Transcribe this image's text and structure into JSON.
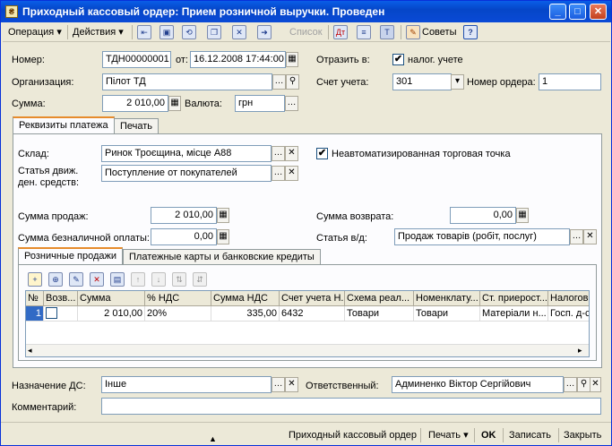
{
  "window": {
    "title": "Приходный кассовый ордер: Прием розничной выручки. Проведен",
    "minimize": "_",
    "maximize": "□",
    "close": "✕"
  },
  "toolbar": {
    "operation": "Операция",
    "actions": "Действия",
    "list": "Список",
    "tips": "Советы",
    "help": "?",
    "dropdown_arrow": "▾"
  },
  "header": {
    "number_label": "Номер:",
    "number_value": "ТДН00000001",
    "from_label": "от:",
    "date_value": "16.12.2008 17:44:00",
    "reflect_label": "Отразить в:",
    "tax_accounting_label": "налог. учете",
    "tax_accounting_checked": "✔",
    "org_label": "Организация:",
    "org_value": "Пілот ТД",
    "account_label": "Счет учета:",
    "account_value": "301",
    "order_no_label": "Номер ордера:",
    "order_no_value": "1",
    "sum_label": "Сумма:",
    "sum_value": "2 010,00",
    "currency_label": "Валюта:",
    "currency_value": "грн"
  },
  "tabs": {
    "payment_details": "Реквизиты платежа",
    "print": "Печать"
  },
  "payment": {
    "warehouse_label": "Склад:",
    "warehouse_value": "Ринок Троєщина, місце А88",
    "non_auto_label": "Неавтоматизированная торговая точка",
    "non_auto_checked": "✔",
    "cashflow_label_1": "Статья движ.",
    "cashflow_label_2": "ден. средств:",
    "cashflow_value": "Поступление от покупателей",
    "sales_sum_label": "Сумма продаж:",
    "sales_sum_value": "2 010,00",
    "return_sum_label": "Сумма возврата:",
    "return_sum_value": "0,00",
    "cashless_label": "Сумма безналичной оплаты:",
    "cashless_value": "0,00",
    "income_item_label": "Статья в/д:",
    "income_item_value": "Продаж товарів (робіт, послуг)"
  },
  "subtabs": {
    "retail": "Розничные продажи",
    "cards": "Платежные карты и банковские кредиты"
  },
  "table": {
    "columns": [
      "№",
      "Возв...",
      "Сумма",
      "% НДС",
      "Сумма НДС",
      "Счет учета Н...",
      "Схема реал...",
      "Номенклату...",
      "Ст. приерост...",
      "Налогов"
    ],
    "rows": [
      [
        "1",
        "",
        "2 010,00",
        "20%",
        "335,00",
        "6432",
        "Товари",
        "Товари",
        "Матеріали н...",
        "Госп. д-сть"
      ]
    ]
  },
  "footer": {
    "purpose_label": "Назначение ДС:",
    "purpose_value": "Інше",
    "responsible_label": "Ответственный:",
    "responsible_value": "Админенко Віктор Сергійович",
    "comment_label": "Комментарий:",
    "comment_value": ""
  },
  "statusbar": {
    "doc": "Приходный кассовый ордер",
    "print": "Печать",
    "ok": "OK",
    "save": "Записать",
    "close": "Закрыть"
  }
}
